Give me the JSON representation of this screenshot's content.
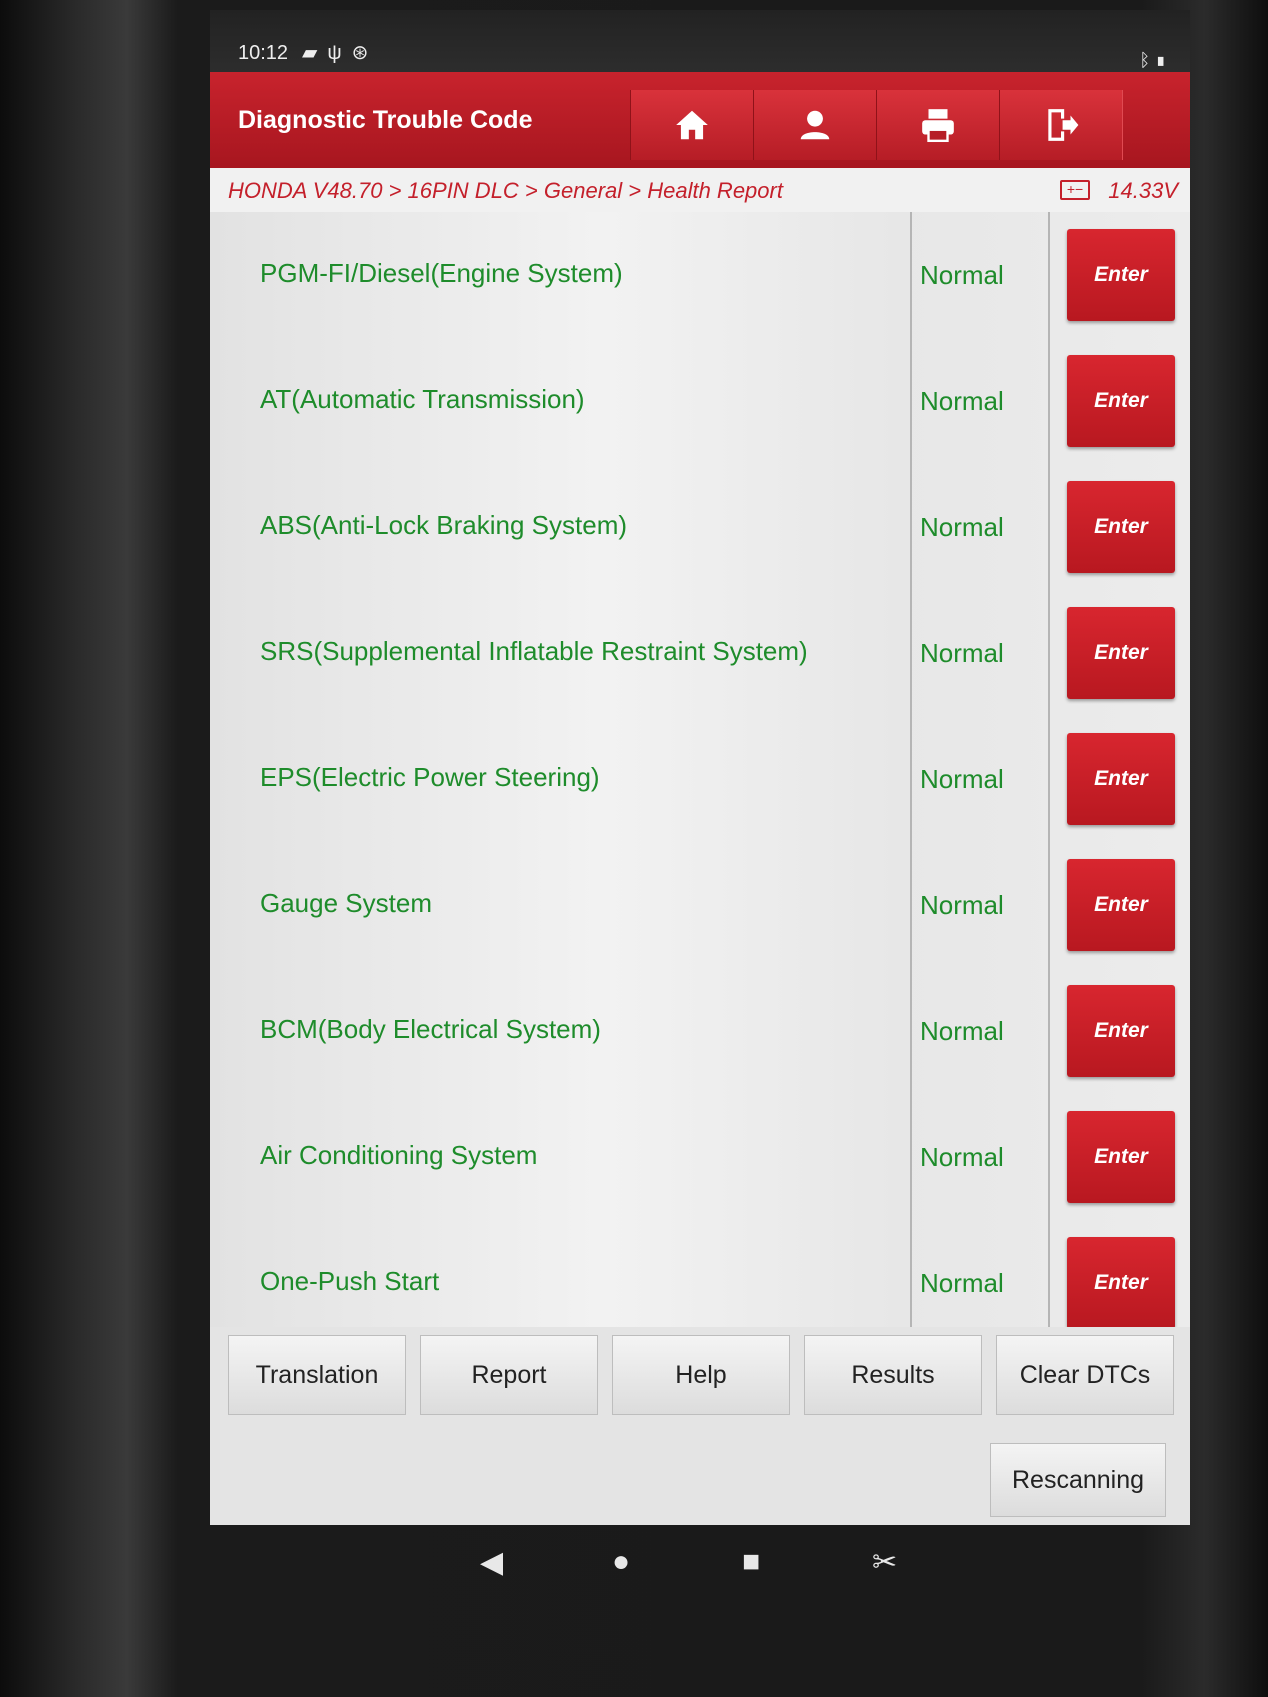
{
  "status_bar": {
    "time": "10:12",
    "left_icons": [
      "gallery-icon",
      "usb-icon",
      "accessibility-icon"
    ],
    "right_icons": [
      "bluetooth-icon",
      "battery-icon"
    ]
  },
  "header": {
    "title": "Diagnostic Trouble Code",
    "buttons": [
      "home-icon",
      "user-icon",
      "print-icon",
      "exit-icon"
    ]
  },
  "breadcrumb": {
    "path": "HONDA V48.70 > 16PIN DLC > General > Health Report",
    "voltage": "14.33V"
  },
  "systems": [
    {
      "name": "PGM-FI/Diesel(Engine System)",
      "status": "Normal",
      "action": "Enter"
    },
    {
      "name": "AT(Automatic Transmission)",
      "status": "Normal",
      "action": "Enter"
    },
    {
      "name": "ABS(Anti-Lock Braking System)",
      "status": "Normal",
      "action": "Enter"
    },
    {
      "name": "SRS(Supplemental Inflatable Restraint System)",
      "status": "Normal",
      "action": "Enter"
    },
    {
      "name": "EPS(Electric Power Steering)",
      "status": "Normal",
      "action": "Enter"
    },
    {
      "name": "Gauge System",
      "status": "Normal",
      "action": "Enter"
    },
    {
      "name": "BCM(Body Electrical System)",
      "status": "Normal",
      "action": "Enter"
    },
    {
      "name": "Air Conditioning System",
      "status": "Normal",
      "action": "Enter"
    },
    {
      "name": "One-Push Start",
      "status": "Normal",
      "action": "Enter"
    }
  ],
  "actions": {
    "translation": "Translation",
    "report": "Report",
    "help": "Help",
    "results": "Results",
    "clear_dtcs": "Clear DTCs",
    "rescanning": "Rescanning"
  },
  "colors": {
    "accent_red": "#c4202b",
    "status_green": "#1e8c2b"
  }
}
